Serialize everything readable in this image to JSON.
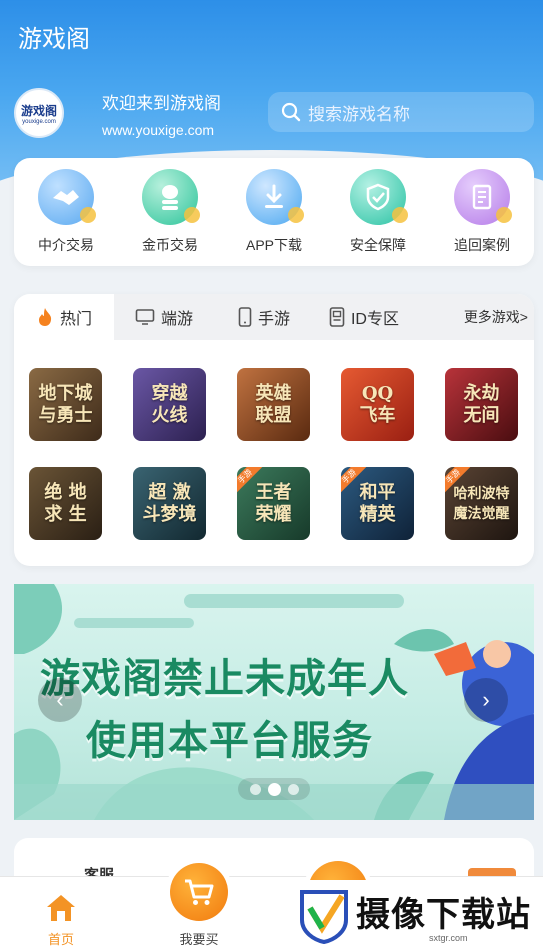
{
  "app": {
    "title": "游戏阁"
  },
  "welcome": {
    "logo_text": "游戏阁",
    "logo_sub": "youxige.com",
    "greeting": "欢迎来到游戏阁",
    "site": "www.youxige.com"
  },
  "search": {
    "placeholder": "搜索游戏名称"
  },
  "services": [
    {
      "label": "中介交易",
      "icon": "handshake-icon",
      "color": "#5aa9f0"
    },
    {
      "label": "金币交易",
      "icon": "coins-icon",
      "color": "#2cc49a"
    },
    {
      "label": "APP下载",
      "icon": "download-icon",
      "color": "#4aa7f0"
    },
    {
      "label": "安全保障",
      "icon": "shield-icon",
      "color": "#29c2a3"
    },
    {
      "label": "追回案例",
      "icon": "receipt-icon",
      "color": "#b57be8"
    }
  ],
  "game_tabs": [
    {
      "label": "热门",
      "icon": "fire-icon",
      "active": true
    },
    {
      "label": "端游",
      "icon": "monitor-icon",
      "active": false
    },
    {
      "label": "手游",
      "icon": "phone-icon",
      "active": false
    },
    {
      "label": "ID专区",
      "icon": "id-card-icon",
      "active": false
    }
  ],
  "more_games": "更多游戏>",
  "games": [
    {
      "name": "地下城与勇士",
      "l1": "地下城",
      "l2": "与勇士",
      "bg": "#6b5034"
    },
    {
      "name": "穿越火线",
      "l1": "穿越",
      "l2": "火线",
      "bg": "#4b3a78"
    },
    {
      "name": "英雄联盟",
      "l1": "英雄",
      "l2": "联盟",
      "bg": "#8b4a22"
    },
    {
      "name": "QQ飞车",
      "l1": "QQ",
      "l2": "飞车",
      "bg": "#c23a1f"
    },
    {
      "name": "永劫无间",
      "l1": "永劫",
      "l2": "无间",
      "bg": "#8b1f22"
    },
    {
      "name": "绝地求生",
      "l1": "绝 地",
      "l2": "求 生",
      "bg": "#4a3a28"
    },
    {
      "name": "超激斗梦境",
      "l1": "超 激",
      "l2": "斗梦境",
      "bg": "#23404a"
    },
    {
      "name": "王者荣耀",
      "l1": "王者",
      "l2": "荣耀",
      "bg": "#2c5a44",
      "badge": "手游"
    },
    {
      "name": "和平精英",
      "l1": "和平",
      "l2": "精英",
      "bg": "#1f3d5a",
      "badge": "手游"
    },
    {
      "name": "哈利波特魔法觉醒",
      "l1": "哈利波特",
      "l2": "魔法觉醒",
      "bg": "#3a2a22",
      "badge": "手游"
    }
  ],
  "banner": {
    "line1": "游戏阁禁止未成年人",
    "line2": "使用本平台服务",
    "slide_count": 3,
    "active_slide": 2
  },
  "bottom_card": {
    "label": "客服"
  },
  "tabbar": {
    "home": "首页",
    "buy": "我要买"
  },
  "watermark": {
    "text": "摄像下载站",
    "sub": "sxtgr.com"
  }
}
